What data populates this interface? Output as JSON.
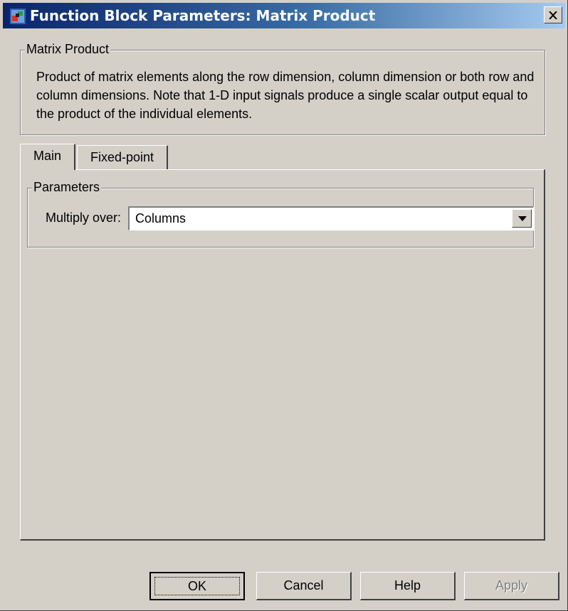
{
  "window": {
    "title": "Function Block Parameters: Matrix Product",
    "icon": "simulink-block-icon",
    "close_icon": "close-icon"
  },
  "description_group": {
    "label": "Matrix Product",
    "text": "Product of matrix elements along the row dimension, column dimension or both row and column dimensions. Note that 1-D input signals produce a single scalar output equal to the product of the individual elements."
  },
  "tabs": [
    {
      "label": "Main",
      "active": true
    },
    {
      "label": "Fixed-point",
      "active": false
    }
  ],
  "parameters": {
    "group_label": "Parameters",
    "multiply_over_label": "Multiply over:",
    "multiply_over_value": "Columns"
  },
  "buttons": {
    "ok": "OK",
    "cancel": "Cancel",
    "help": "Help",
    "apply": "Apply"
  }
}
